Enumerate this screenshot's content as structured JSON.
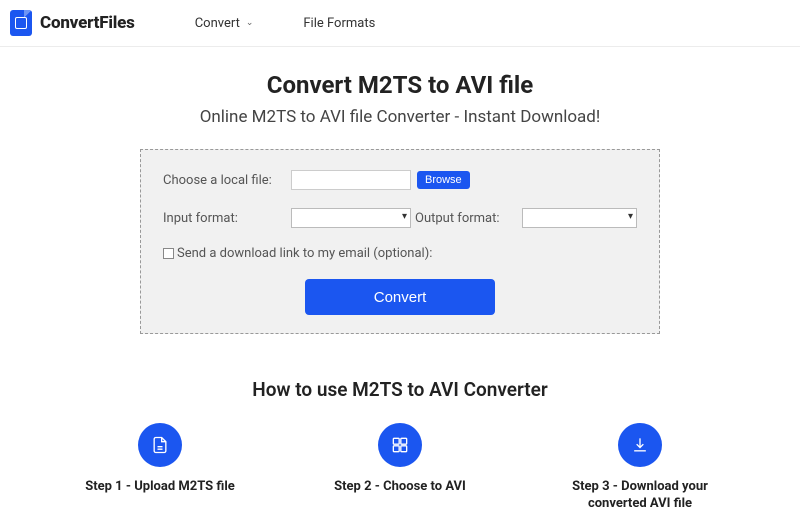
{
  "brand": "ConvertFiles",
  "nav": {
    "convert": "Convert",
    "formats": "File Formats"
  },
  "page": {
    "title": "Convert M2TS to AVI file",
    "subtitle": "Online M2TS to AVI file Converter - Instant Download!"
  },
  "panel": {
    "choose_label": "Choose a local file:",
    "browse": "Browse",
    "input_label": "Input format:",
    "output_label": "Output format:",
    "email_label": "Send a download link to my email (optional):",
    "convert": "Convert"
  },
  "howto": {
    "title": "How to use M2TS to AVI Converter",
    "step1": "Step 1 - Upload M2TS file",
    "step2": "Step 2 - Choose to AVI",
    "step3": "Step 3 - Download your converted AVI file"
  }
}
